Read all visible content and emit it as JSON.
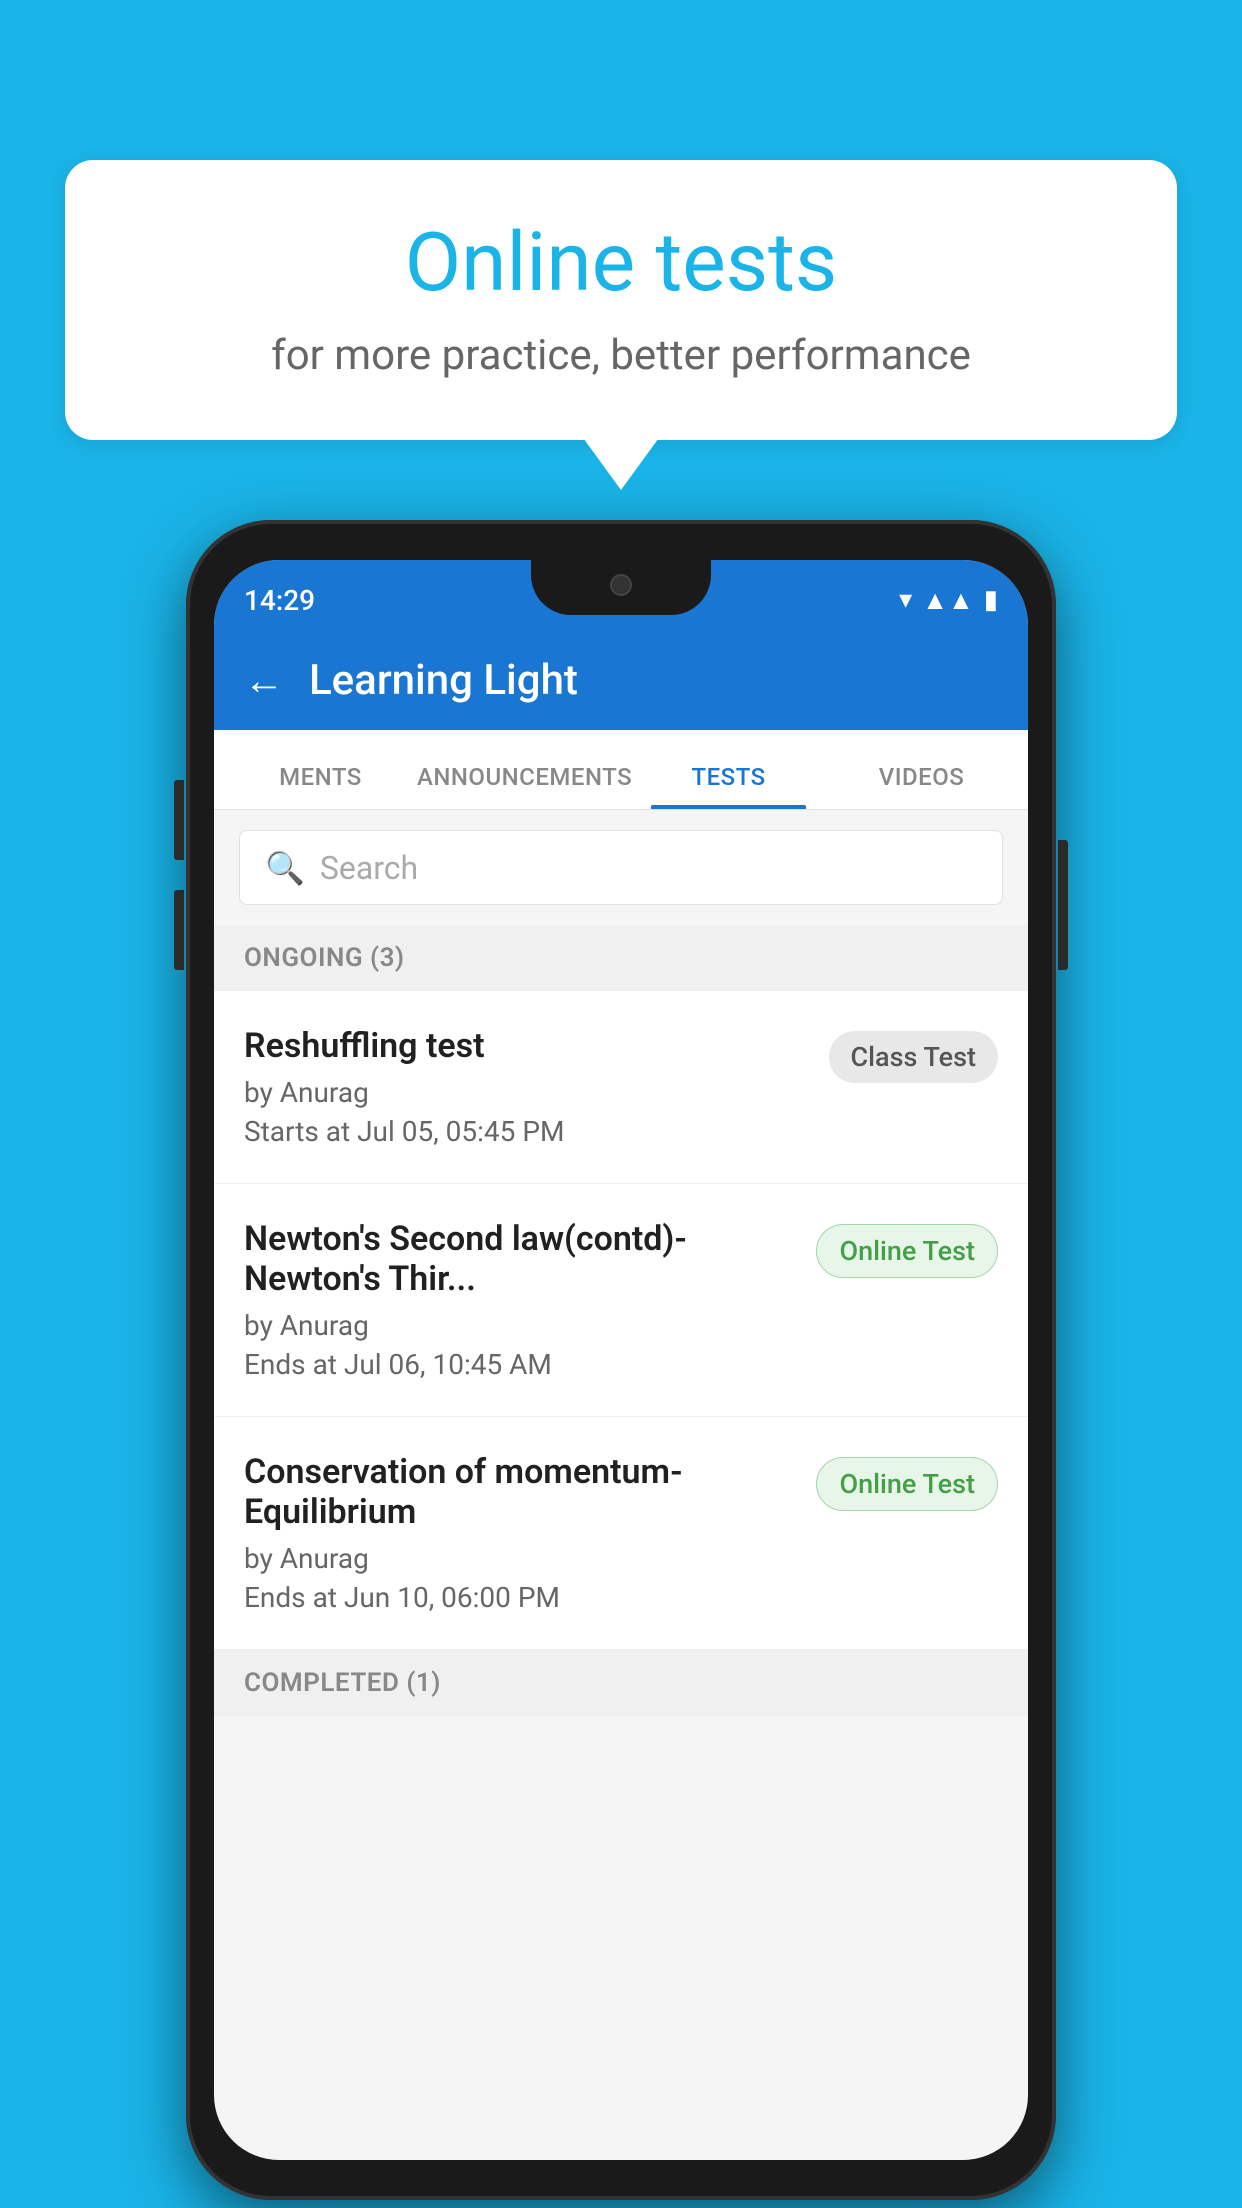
{
  "background_color": "#1ab4e8",
  "bubble": {
    "title": "Online tests",
    "subtitle": "for more practice, better performance"
  },
  "phone": {
    "status_bar": {
      "time": "14:29",
      "wifi": "▼",
      "signal": "▲▲",
      "battery": "▐"
    },
    "app_bar": {
      "title": "Learning Light",
      "back_label": "←"
    },
    "tabs": [
      {
        "label": "MENTS",
        "active": false
      },
      {
        "label": "ANNOUNCEMENTS",
        "active": false
      },
      {
        "label": "TESTS",
        "active": true
      },
      {
        "label": "VIDEOS",
        "active": false
      }
    ],
    "search": {
      "placeholder": "Search"
    },
    "ongoing_section": {
      "label": "ONGOING (3)"
    },
    "tests": [
      {
        "name": "Reshuffling test",
        "author": "by Anurag",
        "time_label": "Starts at",
        "time": "Jul 05, 05:45 PM",
        "badge": "Class Test",
        "badge_type": "class"
      },
      {
        "name": "Newton's Second law(contd)-Newton's Thir...",
        "author": "by Anurag",
        "time_label": "Ends at",
        "time": "Jul 06, 10:45 AM",
        "badge": "Online Test",
        "badge_type": "online"
      },
      {
        "name": "Conservation of momentum-Equilibrium",
        "author": "by Anurag",
        "time_label": "Ends at",
        "time": "Jun 10, 06:00 PM",
        "badge": "Online Test",
        "badge_type": "online"
      }
    ],
    "completed_section": {
      "label": "COMPLETED (1)"
    }
  }
}
